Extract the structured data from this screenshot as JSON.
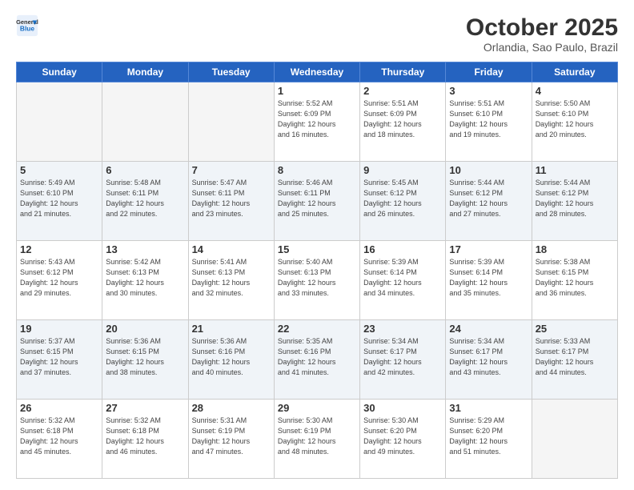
{
  "header": {
    "logo_line1": "General",
    "logo_line2": "Blue",
    "month": "October 2025",
    "location": "Orlandia, Sao Paulo, Brazil"
  },
  "weekdays": [
    "Sunday",
    "Monday",
    "Tuesday",
    "Wednesday",
    "Thursday",
    "Friday",
    "Saturday"
  ],
  "weeks": [
    [
      {
        "day": "",
        "info": ""
      },
      {
        "day": "",
        "info": ""
      },
      {
        "day": "",
        "info": ""
      },
      {
        "day": "1",
        "info": "Sunrise: 5:52 AM\nSunset: 6:09 PM\nDaylight: 12 hours\nand 16 minutes."
      },
      {
        "day": "2",
        "info": "Sunrise: 5:51 AM\nSunset: 6:09 PM\nDaylight: 12 hours\nand 18 minutes."
      },
      {
        "day": "3",
        "info": "Sunrise: 5:51 AM\nSunset: 6:10 PM\nDaylight: 12 hours\nand 19 minutes."
      },
      {
        "day": "4",
        "info": "Sunrise: 5:50 AM\nSunset: 6:10 PM\nDaylight: 12 hours\nand 20 minutes."
      }
    ],
    [
      {
        "day": "5",
        "info": "Sunrise: 5:49 AM\nSunset: 6:10 PM\nDaylight: 12 hours\nand 21 minutes."
      },
      {
        "day": "6",
        "info": "Sunrise: 5:48 AM\nSunset: 6:11 PM\nDaylight: 12 hours\nand 22 minutes."
      },
      {
        "day": "7",
        "info": "Sunrise: 5:47 AM\nSunset: 6:11 PM\nDaylight: 12 hours\nand 23 minutes."
      },
      {
        "day": "8",
        "info": "Sunrise: 5:46 AM\nSunset: 6:11 PM\nDaylight: 12 hours\nand 25 minutes."
      },
      {
        "day": "9",
        "info": "Sunrise: 5:45 AM\nSunset: 6:12 PM\nDaylight: 12 hours\nand 26 minutes."
      },
      {
        "day": "10",
        "info": "Sunrise: 5:44 AM\nSunset: 6:12 PM\nDaylight: 12 hours\nand 27 minutes."
      },
      {
        "day": "11",
        "info": "Sunrise: 5:44 AM\nSunset: 6:12 PM\nDaylight: 12 hours\nand 28 minutes."
      }
    ],
    [
      {
        "day": "12",
        "info": "Sunrise: 5:43 AM\nSunset: 6:12 PM\nDaylight: 12 hours\nand 29 minutes."
      },
      {
        "day": "13",
        "info": "Sunrise: 5:42 AM\nSunset: 6:13 PM\nDaylight: 12 hours\nand 30 minutes."
      },
      {
        "day": "14",
        "info": "Sunrise: 5:41 AM\nSunset: 6:13 PM\nDaylight: 12 hours\nand 32 minutes."
      },
      {
        "day": "15",
        "info": "Sunrise: 5:40 AM\nSunset: 6:13 PM\nDaylight: 12 hours\nand 33 minutes."
      },
      {
        "day": "16",
        "info": "Sunrise: 5:39 AM\nSunset: 6:14 PM\nDaylight: 12 hours\nand 34 minutes."
      },
      {
        "day": "17",
        "info": "Sunrise: 5:39 AM\nSunset: 6:14 PM\nDaylight: 12 hours\nand 35 minutes."
      },
      {
        "day": "18",
        "info": "Sunrise: 5:38 AM\nSunset: 6:15 PM\nDaylight: 12 hours\nand 36 minutes."
      }
    ],
    [
      {
        "day": "19",
        "info": "Sunrise: 5:37 AM\nSunset: 6:15 PM\nDaylight: 12 hours\nand 37 minutes."
      },
      {
        "day": "20",
        "info": "Sunrise: 5:36 AM\nSunset: 6:15 PM\nDaylight: 12 hours\nand 38 minutes."
      },
      {
        "day": "21",
        "info": "Sunrise: 5:36 AM\nSunset: 6:16 PM\nDaylight: 12 hours\nand 40 minutes."
      },
      {
        "day": "22",
        "info": "Sunrise: 5:35 AM\nSunset: 6:16 PM\nDaylight: 12 hours\nand 41 minutes."
      },
      {
        "day": "23",
        "info": "Sunrise: 5:34 AM\nSunset: 6:17 PM\nDaylight: 12 hours\nand 42 minutes."
      },
      {
        "day": "24",
        "info": "Sunrise: 5:34 AM\nSunset: 6:17 PM\nDaylight: 12 hours\nand 43 minutes."
      },
      {
        "day": "25",
        "info": "Sunrise: 5:33 AM\nSunset: 6:17 PM\nDaylight: 12 hours\nand 44 minutes."
      }
    ],
    [
      {
        "day": "26",
        "info": "Sunrise: 5:32 AM\nSunset: 6:18 PM\nDaylight: 12 hours\nand 45 minutes."
      },
      {
        "day": "27",
        "info": "Sunrise: 5:32 AM\nSunset: 6:18 PM\nDaylight: 12 hours\nand 46 minutes."
      },
      {
        "day": "28",
        "info": "Sunrise: 5:31 AM\nSunset: 6:19 PM\nDaylight: 12 hours\nand 47 minutes."
      },
      {
        "day": "29",
        "info": "Sunrise: 5:30 AM\nSunset: 6:19 PM\nDaylight: 12 hours\nand 48 minutes."
      },
      {
        "day": "30",
        "info": "Sunrise: 5:30 AM\nSunset: 6:20 PM\nDaylight: 12 hours\nand 49 minutes."
      },
      {
        "day": "31",
        "info": "Sunrise: 5:29 AM\nSunset: 6:20 PM\nDaylight: 12 hours\nand 51 minutes."
      },
      {
        "day": "",
        "info": ""
      }
    ]
  ]
}
